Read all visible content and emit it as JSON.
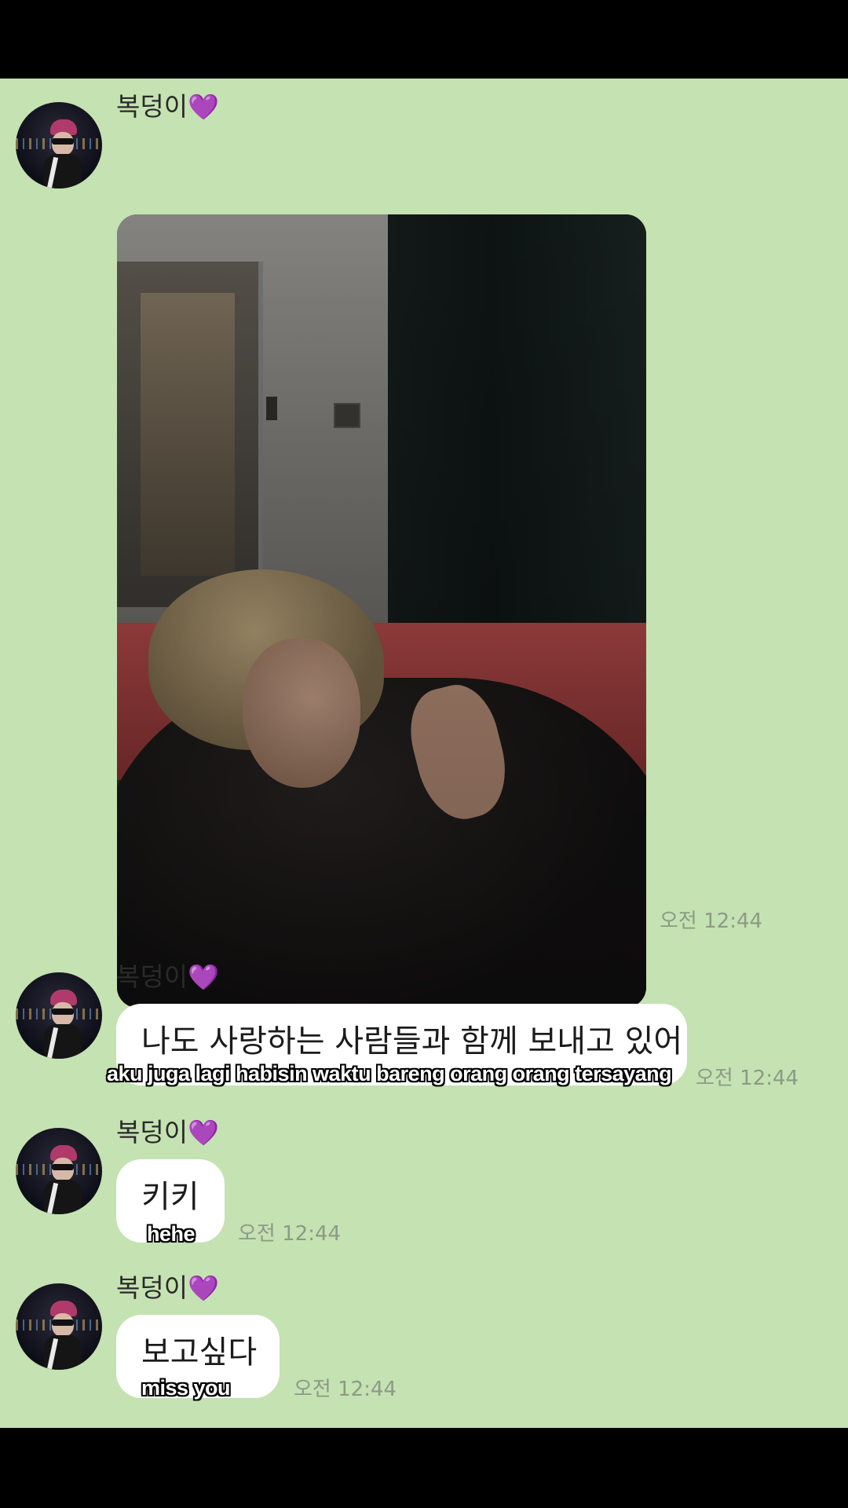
{
  "chat": {
    "sender_name": "복덩이",
    "sender_heart": "💜",
    "messages": [
      {
        "type": "photo",
        "time": "오전 12:44"
      },
      {
        "type": "text",
        "text": "나도 사랑하는 사람들과 함께 보내고 있어",
        "subtitle": "aku juga lagi habisin waktu bareng orang orang tersayang",
        "time": "오전 12:44"
      },
      {
        "type": "text",
        "text": "키키",
        "subtitle": "hehe",
        "time": "오전 12:44"
      },
      {
        "type": "text",
        "text": "보고싶다",
        "subtitle": "miss you",
        "time": "오전 12:44"
      }
    ]
  },
  "colors": {
    "chat_background": "#c5e2b2",
    "bubble": "#ffffff",
    "timestamp": "#8c9a86",
    "letterbox": "#000000"
  }
}
